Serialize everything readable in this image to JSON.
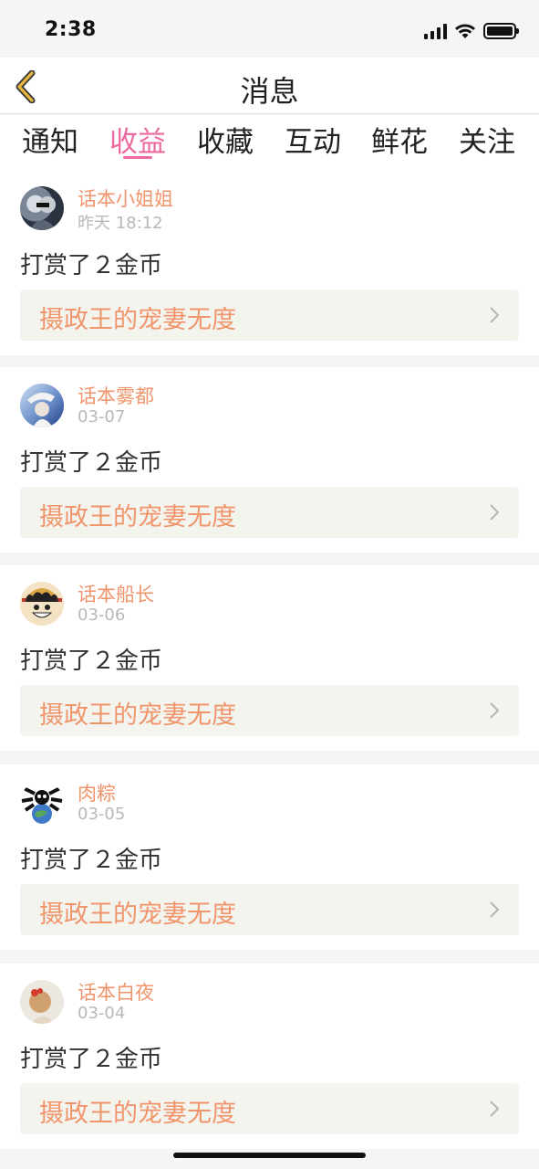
{
  "status_bar": {
    "time": "2:38"
  },
  "nav": {
    "title": "消息"
  },
  "tabs": [
    {
      "label": "通知"
    },
    {
      "label": "收益"
    },
    {
      "label": "收藏"
    },
    {
      "label": "互动"
    },
    {
      "label": "鲜花"
    },
    {
      "label": "关注"
    }
  ],
  "active_tab": "收益",
  "messages": [
    {
      "user": "话本小姐姐",
      "time": "昨天 18:12",
      "text": "打赏了２金币",
      "work": "摄政王的宠妻无度"
    },
    {
      "user": "话本雾都",
      "time": "03-07",
      "text": "打赏了２金币",
      "work": "摄政王的宠妻无度"
    },
    {
      "user": "话本船长",
      "time": "03-06",
      "text": "打赏了２金币",
      "work": "摄政王的宠妻无度"
    },
    {
      "user": "肉粽",
      "time": "03-05",
      "text": "打赏了２金币",
      "work": "摄政王的宠妻无度"
    },
    {
      "user": "话本白夜",
      "time": "03-04",
      "text": "打赏了２金币",
      "work": "摄政王的宠妻无度"
    }
  ],
  "colors": {
    "accent": "#ec6aa0",
    "name": "#f0956b",
    "muted": "#b8b8b8"
  }
}
